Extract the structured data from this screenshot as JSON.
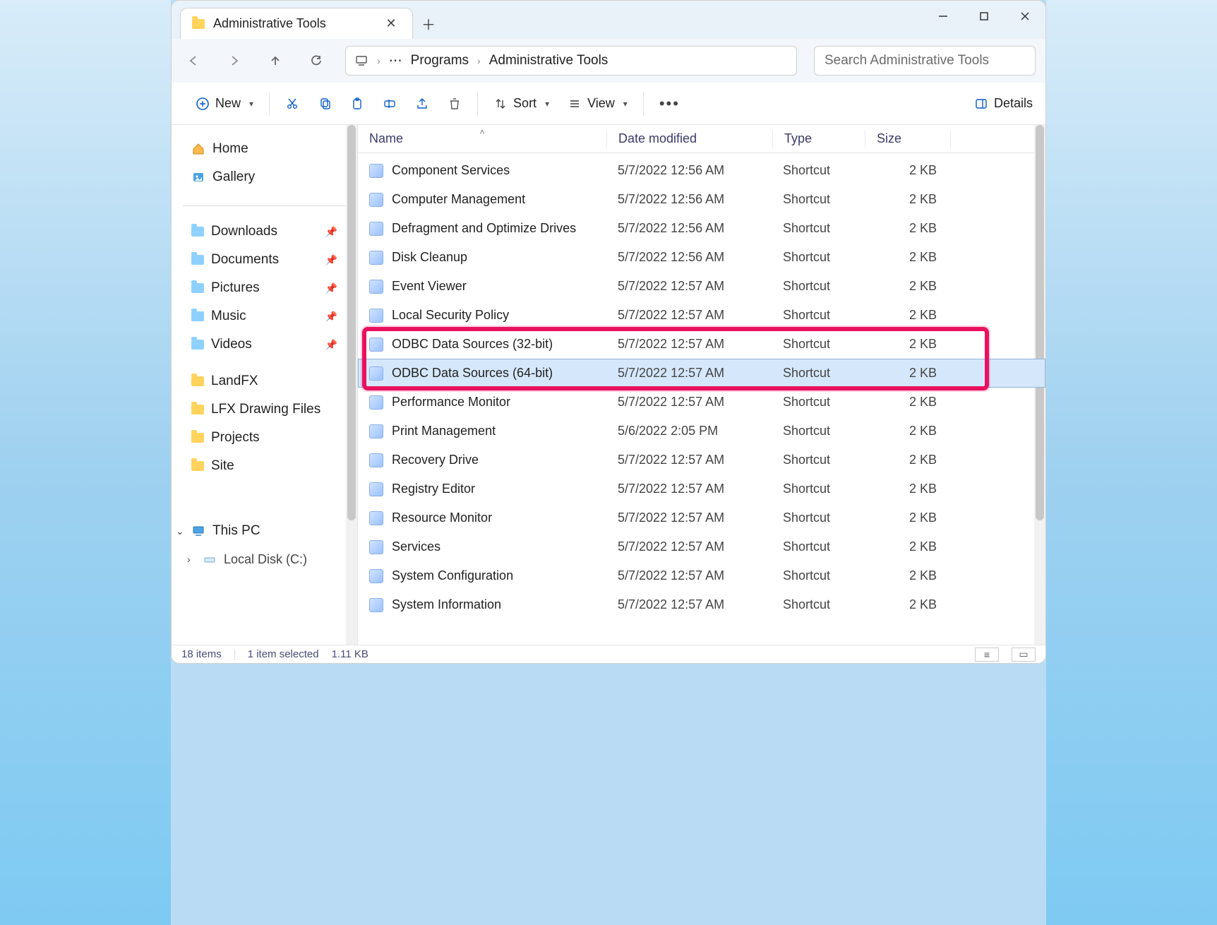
{
  "tab": {
    "title": "Administrative Tools"
  },
  "address": {
    "crumb1": "Programs",
    "crumb2": "Administrative Tools"
  },
  "search": {
    "placeholder": "Search Administrative Tools"
  },
  "toolbar": {
    "new": "New",
    "sort": "Sort",
    "view": "View",
    "details": "Details"
  },
  "sidebar": {
    "top": [
      {
        "label": "Home",
        "icon": "home"
      },
      {
        "label": "Gallery",
        "icon": "gallery"
      }
    ],
    "pinned": [
      {
        "label": "Downloads",
        "icon": "cyan"
      },
      {
        "label": "Documents",
        "icon": "cyan"
      },
      {
        "label": "Pictures",
        "icon": "cyan"
      },
      {
        "label": "Music",
        "icon": "cyan"
      },
      {
        "label": "Videos",
        "icon": "cyan"
      }
    ],
    "folders": [
      {
        "label": "LandFX"
      },
      {
        "label": "LFX Drawing Files"
      },
      {
        "label": "Projects"
      },
      {
        "label": "Site"
      }
    ],
    "pc": {
      "label": "This PC",
      "sub": "Local Disk (C:)"
    }
  },
  "columns": {
    "name": "Name",
    "date": "Date modified",
    "type": "Type",
    "size": "Size"
  },
  "rows": [
    {
      "name": "Component Services",
      "date": "5/7/2022 12:56 AM",
      "type": "Shortcut",
      "size": "2 KB"
    },
    {
      "name": "Computer Management",
      "date": "5/7/2022 12:56 AM",
      "type": "Shortcut",
      "size": "2 KB"
    },
    {
      "name": "Defragment and Optimize Drives",
      "date": "5/7/2022 12:56 AM",
      "type": "Shortcut",
      "size": "2 KB"
    },
    {
      "name": "Disk Cleanup",
      "date": "5/7/2022 12:56 AM",
      "type": "Shortcut",
      "size": "2 KB"
    },
    {
      "name": "Event Viewer",
      "date": "5/7/2022 12:57 AM",
      "type": "Shortcut",
      "size": "2 KB"
    },
    {
      "name": "Local Security Policy",
      "date": "5/7/2022 12:57 AM",
      "type": "Shortcut",
      "size": "2 KB"
    },
    {
      "name": "ODBC Data Sources (32-bit)",
      "date": "5/7/2022 12:57 AM",
      "type": "Shortcut",
      "size": "2 KB"
    },
    {
      "name": "ODBC Data Sources (64-bit)",
      "date": "5/7/2022 12:57 AM",
      "type": "Shortcut",
      "size": "2 KB",
      "selected": true
    },
    {
      "name": "Performance Monitor",
      "date": "5/7/2022 12:57 AM",
      "type": "Shortcut",
      "size": "2 KB"
    },
    {
      "name": "Print Management",
      "date": "5/6/2022 2:05 PM",
      "type": "Shortcut",
      "size": "2 KB"
    },
    {
      "name": "Recovery Drive",
      "date": "5/7/2022 12:57 AM",
      "type": "Shortcut",
      "size": "2 KB"
    },
    {
      "name": "Registry Editor",
      "date": "5/7/2022 12:57 AM",
      "type": "Shortcut",
      "size": "2 KB"
    },
    {
      "name": "Resource Monitor",
      "date": "5/7/2022 12:57 AM",
      "type": "Shortcut",
      "size": "2 KB"
    },
    {
      "name": "Services",
      "date": "5/7/2022 12:57 AM",
      "type": "Shortcut",
      "size": "2 KB"
    },
    {
      "name": "System Configuration",
      "date": "5/7/2022 12:57 AM",
      "type": "Shortcut",
      "size": "2 KB"
    },
    {
      "name": "System Information",
      "date": "5/7/2022 12:57 AM",
      "type": "Shortcut",
      "size": "2 KB"
    }
  ],
  "highlight": {
    "start": 6,
    "end": 7
  },
  "status": {
    "items": "18 items",
    "selected": "1 item selected",
    "size": "1.11 KB"
  }
}
